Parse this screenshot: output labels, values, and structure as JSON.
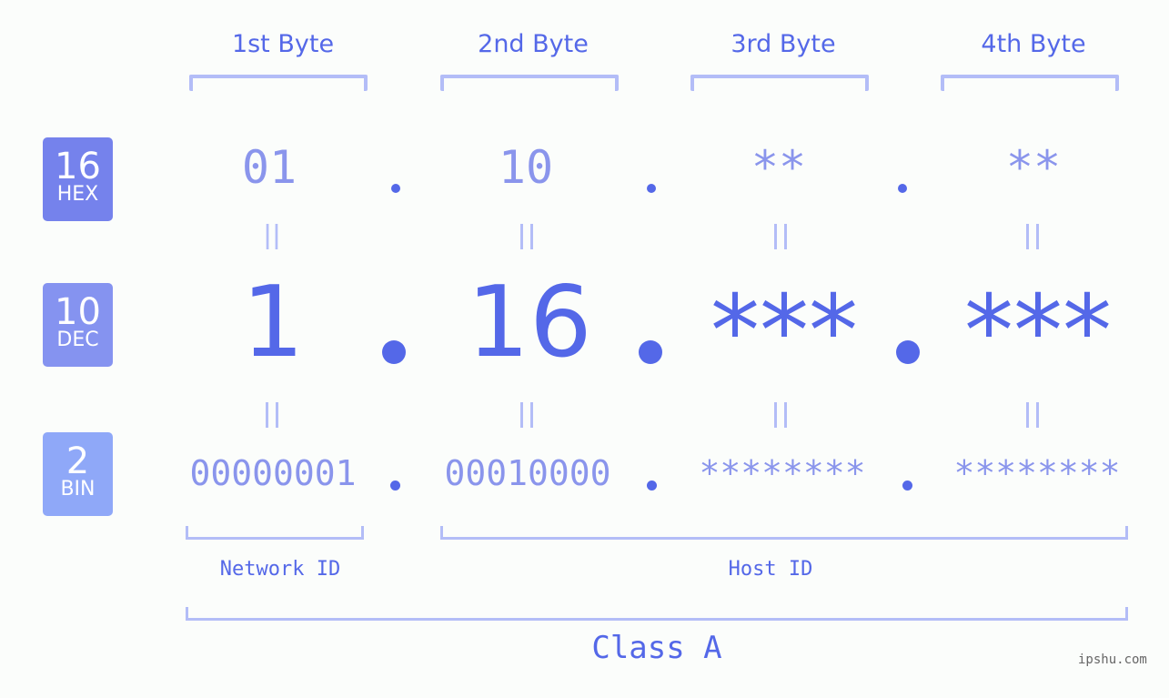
{
  "headers": [
    "1st Byte",
    "2nd Byte",
    "3rd Byte",
    "4th Byte"
  ],
  "badges": [
    {
      "num": "16",
      "label": "HEX",
      "color": "#7582ec"
    },
    {
      "num": "10",
      "label": "DEC",
      "color": "#8593f0"
    },
    {
      "num": "2",
      "label": "BIN",
      "color": "#8fa8f8"
    }
  ],
  "hex": [
    "01",
    "10",
    "**",
    "**"
  ],
  "dec": [
    "1",
    "16",
    "***",
    "***"
  ],
  "bin": [
    "00000001",
    "00010000",
    "********",
    "********"
  ],
  "equals_sign": "=",
  "labels": {
    "network": "Network ID",
    "host": "Host ID",
    "class": "Class A"
  },
  "watermark": "ipshu.com"
}
